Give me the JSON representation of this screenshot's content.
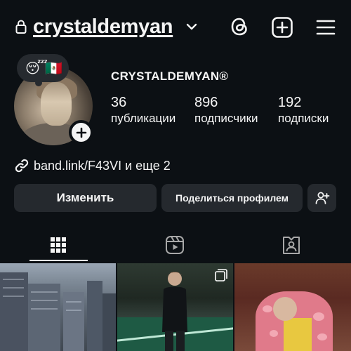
{
  "header": {
    "username": "crystaldemyan"
  },
  "note": {
    "emojis": [
      "😴",
      "🇲🇽"
    ]
  },
  "profile": {
    "display_name": "CRYSTALDEMYAN®",
    "stats": {
      "posts": {
        "value": "36",
        "label": "публикации"
      },
      "followers": {
        "value": "896",
        "label": "подписчики"
      },
      "following": {
        "value": "192",
        "label": "подписки"
      }
    },
    "link": "band.link/F43VI и еще 2"
  },
  "actions": {
    "edit_label": "Изменить",
    "share_label": "Поделиться профилем"
  },
  "tabs": {
    "active": "grid"
  },
  "colors": {
    "background": "#0c1014",
    "button": "#25292e",
    "text": "#f5f5f5"
  }
}
